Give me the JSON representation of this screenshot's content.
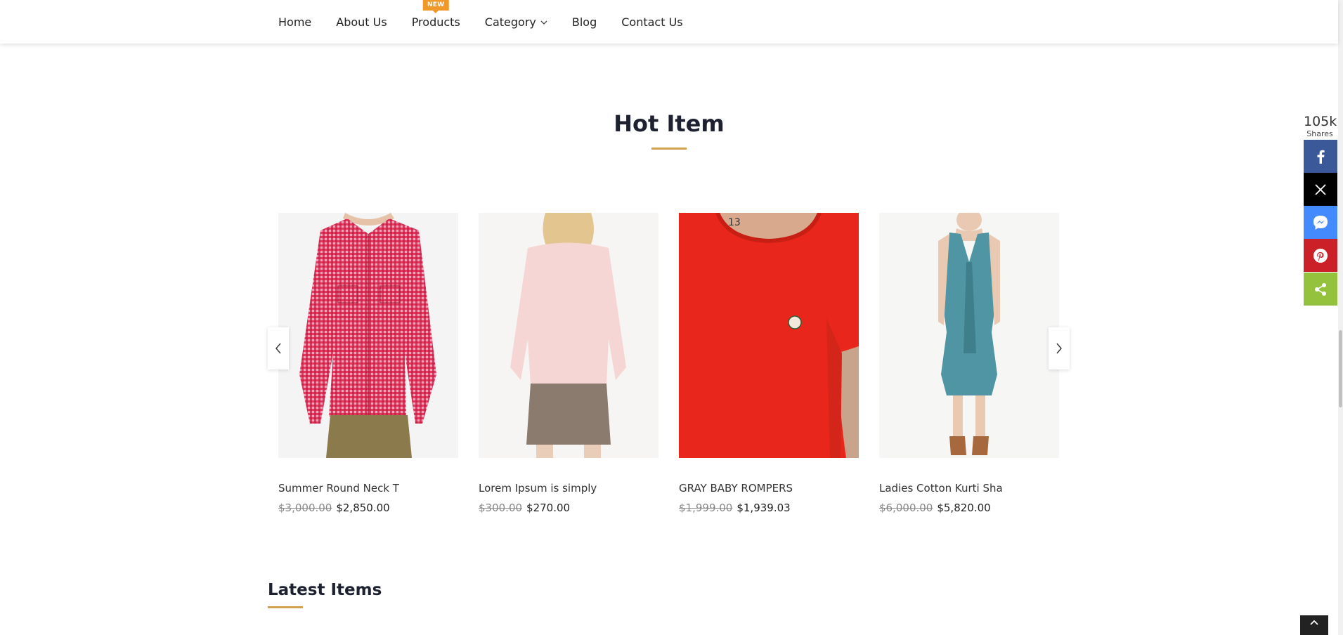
{
  "nav": {
    "items": [
      {
        "label": "Home"
      },
      {
        "label": "About Us"
      },
      {
        "label": "Products",
        "badge": "NEW"
      },
      {
        "label": "Category",
        "has_dropdown": true
      },
      {
        "label": "Blog"
      },
      {
        "label": "Contact Us"
      }
    ]
  },
  "hot_section": {
    "title": "Hot Item",
    "products": [
      {
        "name": "Summer Round Neck T",
        "old_price": "$3,000.00",
        "price": "$2,850.00",
        "image": "red-checkered-shirt"
      },
      {
        "name": "Lorem Ipsum is simply",
        "old_price": "$300.00",
        "price": "$270.00",
        "image": "pink-sweater-skirt"
      },
      {
        "name": "GRAY BABY ROMPERS",
        "old_price": "$1,999.00",
        "price": "$1,939.03",
        "image": "red-tshirt"
      },
      {
        "name": "Ladies Cotton Kurti Sha",
        "old_price": "$6,000.00",
        "price": "$5,820.00",
        "image": "teal-dress"
      }
    ]
  },
  "latest_section": {
    "title": "Latest Items"
  },
  "share": {
    "count": "105k",
    "label": "Shares",
    "buttons": [
      {
        "network": "facebook",
        "icon": "facebook-icon",
        "color": "#3b5998"
      },
      {
        "network": "x",
        "icon": "x-icon",
        "color": "#000000"
      },
      {
        "network": "messenger",
        "icon": "messenger-icon",
        "color": "#448aff"
      },
      {
        "network": "pinterest",
        "icon": "pinterest-icon",
        "color": "#cb2027"
      },
      {
        "network": "share",
        "icon": "share-icon",
        "color": "#95c23d"
      }
    ]
  },
  "colors": {
    "accent": "#d2a14d",
    "badge": "#f0992a"
  }
}
